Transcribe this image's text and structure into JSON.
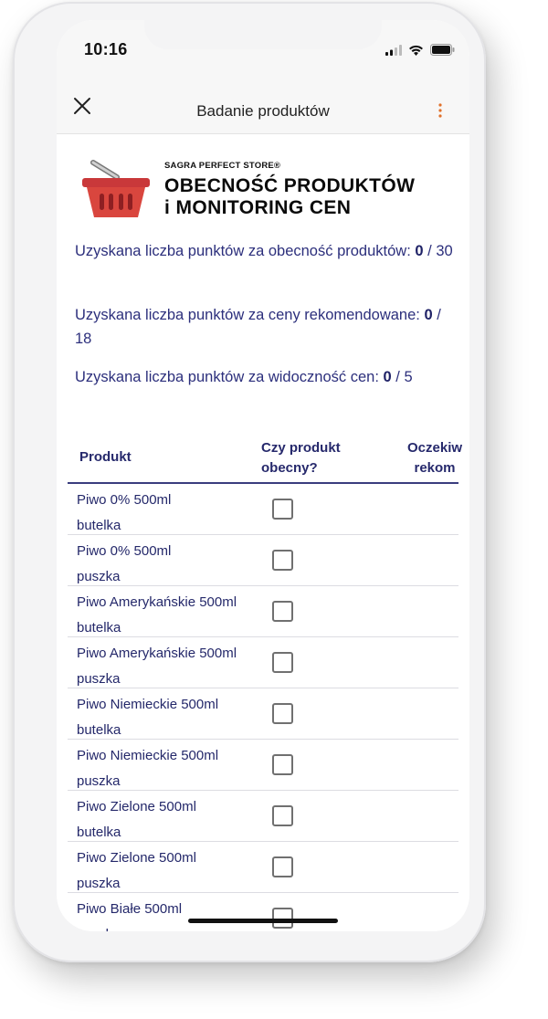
{
  "status_bar": {
    "time": "10:16",
    "icons": [
      "signal-icon",
      "wifi-icon",
      "battery-icon"
    ]
  },
  "app_bar": {
    "title": "Badanie produktów",
    "close_icon": "close-icon",
    "menu_icon": "more-vertical-icon"
  },
  "brand": {
    "small": "SAGRA PERFECT STORE®",
    "title_line1": "OBECNOŚĆ PRODUKTÓW",
    "title_line2": "i MONITORING CEN",
    "icon": "basket-icon"
  },
  "scores": [
    {
      "label": "Uzyskana liczba punktów za obecność produktów:",
      "value": "0",
      "max": "/ 30"
    },
    {
      "label": "Uzyskana liczba punktów za ceny rekomendowane:",
      "value": "0",
      "max": "/ 18"
    },
    {
      "label": "Uzyskana liczba punktów za widoczność cen:",
      "value": "0",
      "max": "/ 5"
    }
  ],
  "table": {
    "headers": {
      "product": "Produkt",
      "present_line1": "Czy produkt",
      "present_line2": "obecny?",
      "expected_line1": "Oczekiw",
      "expected_line2": "rekom"
    },
    "rows": [
      {
        "name_line1": "Piwo 0% 500ml",
        "name_line2": "butelka",
        "present": false
      },
      {
        "name_line1": "Piwo 0% 500ml",
        "name_line2": "puszka",
        "present": false
      },
      {
        "name_line1": "Piwo Amerykańskie 500ml",
        "name_line2": "butelka",
        "present": false
      },
      {
        "name_line1": "Piwo Amerykańskie 500ml",
        "name_line2": "puszka",
        "present": false
      },
      {
        "name_line1": "Piwo Niemieckie 500ml",
        "name_line2": "butelka",
        "present": false
      },
      {
        "name_line1": "Piwo Niemieckie 500ml",
        "name_line2": "puszka",
        "present": false
      },
      {
        "name_line1": "Piwo Zielone 500ml",
        "name_line2": "butelka",
        "present": false
      },
      {
        "name_line1": "Piwo Zielone 500ml",
        "name_line2": "puszka",
        "present": false
      },
      {
        "name_line1": "Piwo Białe 500ml",
        "name_line2": "puszka",
        "present": false
      }
    ]
  },
  "colors": {
    "text_primary": "#2c2f7c",
    "basket_red": "#d9463e",
    "menu_dots": "#e0702a"
  }
}
